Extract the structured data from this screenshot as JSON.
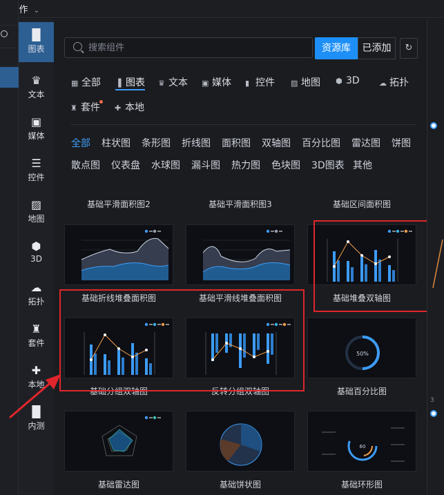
{
  "topbar": {
    "operate": "操作",
    "chevron": "⌄"
  },
  "sidebar": {
    "items": [
      {
        "label": "图表",
        "icon": "bar-chart-icon",
        "glyph": "▐▌",
        "active": true
      },
      {
        "label": "文本",
        "icon": "crown-text-icon",
        "glyph": "♛",
        "active": false
      },
      {
        "label": "媒体",
        "icon": "camera-icon",
        "glyph": "▣",
        "active": false
      },
      {
        "label": "控件",
        "icon": "list-icon",
        "glyph": "☰",
        "active": false
      },
      {
        "label": "地图",
        "icon": "map-icon",
        "glyph": "▨",
        "active": false
      },
      {
        "label": "3D",
        "icon": "cube-icon",
        "glyph": "⬢",
        "active": false
      },
      {
        "label": "拓扑",
        "icon": "cloud-icon",
        "glyph": "☁",
        "active": false
      },
      {
        "label": "套件",
        "icon": "shirt-icon",
        "glyph": "♜",
        "active": false
      },
      {
        "label": "本地",
        "icon": "puzzle-icon",
        "glyph": "✚",
        "active": false
      },
      {
        "label": "内测",
        "icon": "bar-chart-beta-icon",
        "glyph": "▐▌",
        "active": false
      }
    ]
  },
  "search": {
    "placeholder": "搜索组件"
  },
  "buttons": {
    "library": "资源库",
    "added": "已添加",
    "refresh_glyph": "↻"
  },
  "categories": [
    {
      "label": "全部",
      "glyph": "▦",
      "icon": "grid-icon"
    },
    {
      "label": "图表",
      "glyph": "▐",
      "icon": "bar-chart-icon"
    },
    {
      "label": "文本",
      "glyph": "♛",
      "icon": "crown-icon"
    },
    {
      "label": "媒体",
      "glyph": "▣",
      "icon": "media-icon"
    },
    {
      "label": "控件",
      "glyph": "▮",
      "icon": "control-icon"
    },
    {
      "label": "地图",
      "glyph": "▨",
      "icon": "map-icon"
    },
    {
      "label": "3D",
      "glyph": "⬢",
      "icon": "cube-icon"
    },
    {
      "label": "拓扑",
      "glyph": "☁",
      "icon": "cloud-icon"
    },
    {
      "label": "套件",
      "glyph": "♜",
      "icon": "kit-icon"
    },
    {
      "label": "本地",
      "glyph": "✚",
      "icon": "puzzle-icon"
    }
  ],
  "subcategories": [
    "全部",
    "柱状图",
    "条形图",
    "折线图",
    "面积图",
    "双轴图",
    "百分比图",
    "雷达图",
    "饼图",
    "散点图",
    "仪表盘",
    "水球图",
    "漏斗图",
    "热力图",
    "色块图",
    "3D图表",
    "其他"
  ],
  "cards": [
    "基础平滑面积图2",
    "基础平滑面积图3",
    "基础区间面积图",
    "基础折线堆叠面积图",
    "基础平滑线堆叠面积图",
    "基础堆叠双轴图",
    "基础分组双轴图",
    "反转分组双轴图",
    "基础百分比图",
    "基础雷达图",
    "基础饼状图",
    "基础环形图"
  ],
  "percent_value": "50%",
  "ring_center": "60",
  "colors": {
    "accent": "#1d8ff7",
    "highlight_box": "#e0262b",
    "panel": "#1b1c20"
  }
}
